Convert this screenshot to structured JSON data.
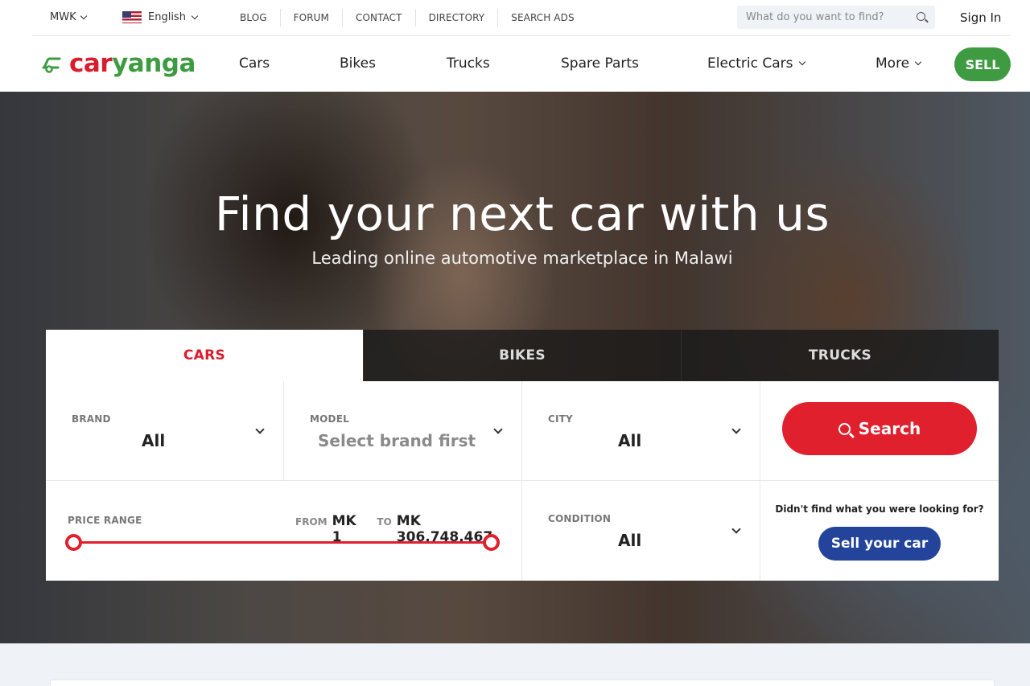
{
  "topbar": {
    "currency": "MWK",
    "language": "English",
    "links": [
      "BLOG",
      "FORUM",
      "CONTACT",
      "DIRECTORY",
      "SEARCH ADS"
    ],
    "search_placeholder": "What do you want to find?",
    "sign_in": "Sign In"
  },
  "brand": {
    "logo_part1": "car",
    "logo_part2": "yanga",
    "red": "#d91d2c",
    "green": "#3e9b41"
  },
  "nav": {
    "items": [
      "Cars",
      "Bikes",
      "Trucks",
      "Spare Parts",
      "Electric Cars",
      "More"
    ],
    "sell": "SELL"
  },
  "hero": {
    "title": "Find your next car with us",
    "subtitle": "Leading online automotive marketplace in Malawi"
  },
  "search_panel": {
    "tabs": [
      "CARS",
      "BIKES",
      "TRUCKS"
    ],
    "active_tab": "CARS",
    "brand": {
      "label": "BRAND",
      "value": "All"
    },
    "model": {
      "label": "MODEL",
      "value": "Select brand first"
    },
    "city": {
      "label": "CITY",
      "value": "All"
    },
    "search_button": "Search",
    "price": {
      "label": "PRICE RANGE",
      "from_label": "FROM",
      "from_value": "MK 1",
      "to_label": "TO",
      "to_value": "MK 306,748,467"
    },
    "condition": {
      "label": "CONDITION",
      "value": "All"
    },
    "sell_prompt": "Didn't find what you were looking for?",
    "sell_button": "Sell your car",
    "accent": "#e0202d",
    "sell_button_color": "#23449a"
  },
  "icons": [
    "chevron-down-icon",
    "us-flag-icon",
    "search-icon",
    "car-logo-icon"
  ]
}
